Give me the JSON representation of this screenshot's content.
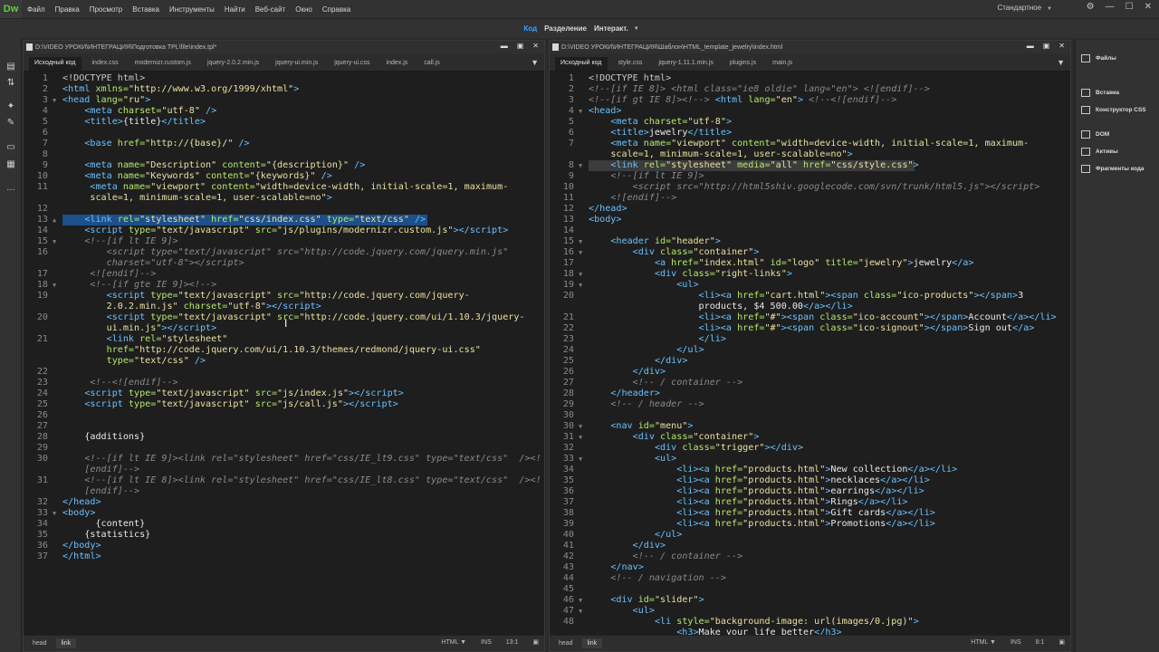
{
  "app": {
    "logo": "Dw",
    "workspace": "Стандартное"
  },
  "menu": [
    "Файл",
    "Правка",
    "Просмотр",
    "Вставка",
    "Инструменты",
    "Найти",
    "Веб-сайт",
    "Окно",
    "Справка"
  ],
  "views": {
    "code": "Код",
    "split": "Разделение",
    "interactive": "Интеракт."
  },
  "left_pane": {
    "path": "D:\\VIDEO УРОКИ\\ИНТЕГРАЦИЯ\\Подготовка TPL\\file\\index.tpl*",
    "tabs": [
      "Исходный код",
      "index.css",
      "modernizr.custom.js",
      "jquery-2.0.2.min.js",
      "jquery-ui.min.js",
      "jquery-ui.css",
      "index.js",
      "call.js"
    ],
    "breadcrumb": [
      "head",
      "link"
    ],
    "status": {
      "lang": "HTML",
      "mode": "INS",
      "pos": "13:1"
    }
  },
  "right_pane": {
    "path": "D:\\VIDEO УРОКИ\\ИНТЕГРАЦИЯ\\Шаблон\\HTML_template_jewelry\\index.html",
    "tabs": [
      "Исходный код",
      "style.css",
      "jquery-1.11.1.min.js",
      "plugins.js",
      "main.js"
    ],
    "breadcrumb": [
      "head",
      "link"
    ],
    "status": {
      "lang": "HTML",
      "mode": "INS",
      "pos": "8:1"
    }
  },
  "panels": [
    "Файлы",
    "Вставка",
    "Конструктор CSS",
    "DOM",
    "Активы",
    "Фрагменты кода"
  ],
  "icons": {
    "filter": "filter-icon",
    "settings": "gear-icon",
    "minimize": "minimize-icon",
    "maximize": "maximize-icon",
    "close": "close-icon"
  }
}
